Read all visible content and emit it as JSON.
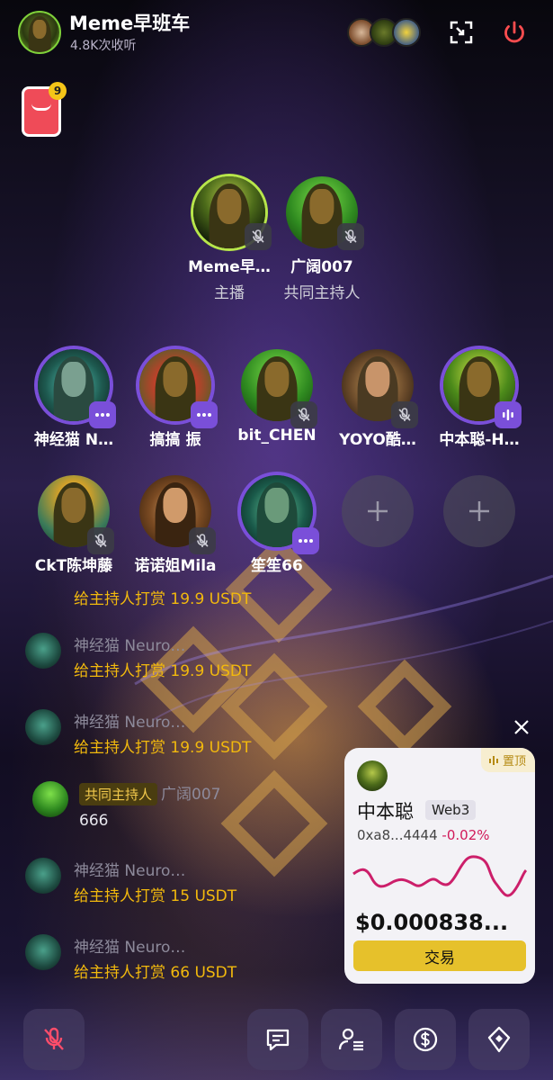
{
  "header": {
    "title": "Meme早班车",
    "listens": "4.8K次收听"
  },
  "envelope": {
    "count": "9"
  },
  "hosts": [
    {
      "name": "Meme早…",
      "role": "主播"
    },
    {
      "name": "广阔007",
      "role": "共同主持人"
    }
  ],
  "speakers_row1": [
    {
      "name": "神经猫 N…"
    },
    {
      "name": "搞搞  振"
    },
    {
      "name": "bit_CHEN"
    },
    {
      "name": "YOYO酷…"
    },
    {
      "name": "中本聪-H…"
    }
  ],
  "speakers_row2": [
    {
      "name": "CkT陈坤藤"
    },
    {
      "name": "诺诺姐Mila"
    },
    {
      "name": "笙笙66"
    }
  ],
  "chat": [
    {
      "name": "",
      "msg": "给主持人打赏 19.9 USDT"
    },
    {
      "name": "神经猫 Neuro…",
      "msg": "给主持人打赏 19.9 USDT"
    },
    {
      "name": "神经猫 Neuro…",
      "msg": "给主持人打赏 19.9 USDT"
    },
    {
      "tag": "共同主持人",
      "name": "广阔007",
      "msg": "666"
    },
    {
      "name": "神经猫 Neuro…",
      "msg": "给主持人打赏 15 USDT"
    },
    {
      "name": "神经猫 Neuro…",
      "msg": "给主持人打赏 66 USDT"
    }
  ],
  "token_card": {
    "pin_label": "置顶",
    "name": "中本聪",
    "tag": "Web3",
    "address": "0xa8...4444",
    "change": "-0.02%",
    "price": "$0.000838...",
    "trade_label": "交易",
    "chart_color": "#cc1f6a"
  },
  "colors": {
    "accent_purple": "#7a4fd9",
    "gold": "#f2b90d",
    "red_power": "#ff4d4f"
  },
  "icons": {
    "fullscreen": "shrink-window-icon",
    "power": "power-icon",
    "mic": "mic-off-icon",
    "chat": "message-icon",
    "users": "user-list-icon",
    "tip": "dollar-coin-icon",
    "web3": "cube-icon"
  }
}
